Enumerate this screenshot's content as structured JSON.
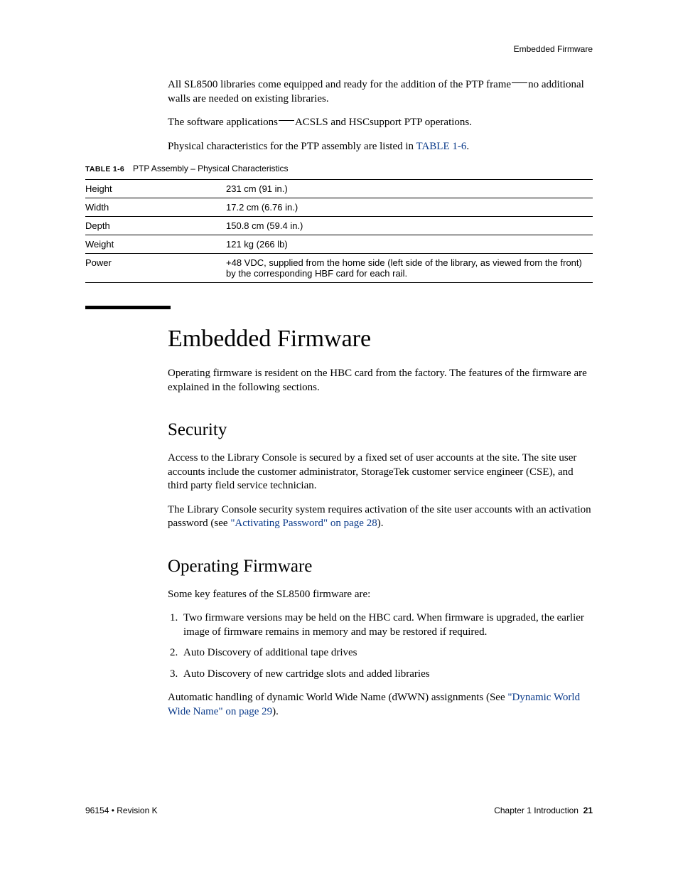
{
  "running_head": "Embedded Firmware",
  "intro": {
    "p1a": "All SL8500 libraries come equipped and ready for the addition of the PTP frame",
    "p1b": "no additional walls are needed on existing libraries.",
    "p2a": "The software applications",
    "p2b": "ACSLS and HSCsupport PTP operations.",
    "p3a": "Physical characteristics for the PTP assembly are listed in ",
    "p3_link": "TABLE 1-6",
    "p3b": "."
  },
  "table": {
    "caption_label": "TABLE 1-6",
    "caption_text": "PTP Assembly – Physical Characteristics",
    "rows": [
      {
        "k": "Height",
        "v": "231 cm (91 in.)"
      },
      {
        "k": "Width",
        "v": "17.2 cm (6.76 in.)"
      },
      {
        "k": "Depth",
        "v": "150.8 cm (59.4 in.)"
      },
      {
        "k": "Weight",
        "v": "121 kg (266 lb)"
      },
      {
        "k": "Power",
        "v": "+48 VDC, supplied from the home side (left side of the library, as viewed from the front) by the corresponding HBF card for each rail."
      }
    ]
  },
  "embedded": {
    "title": "Embedded Firmware",
    "p1": "Operating firmware is resident on the HBC card from the factory. The features of the firmware are explained in the following sections."
  },
  "security": {
    "title": "Security",
    "p1": "Access to the Library Console is secured by a fixed set of user accounts at the site. The site user accounts include the customer administrator, StorageTek customer service engineer (CSE), and third party field service technician.",
    "p2a": "The Library Console security system requires activation of the site user accounts with an activation password (see ",
    "p2_link": "\"Activating Password\" on page 28",
    "p2b": ")."
  },
  "opfw": {
    "title": "Operating Firmware",
    "p1": "Some key features of the SL8500 firmware are:",
    "items": [
      "Two firmware versions may be held on the HBC card. When firmware is upgraded, the earlier image of firmware remains in memory and may be restored if required.",
      "Auto Discovery of additional tape drives",
      "Auto Discovery of new cartridge slots and added libraries"
    ],
    "p2a": "Automatic handling of dynamic World Wide Name (dWWN) assignments (See ",
    "p2_link": "\"Dynamic World Wide Name\" on page 29",
    "p2b": ")."
  },
  "footer": {
    "left": "96154 • Revision K",
    "right_text": "Chapter 1 Introduction",
    "right_page": "21"
  }
}
